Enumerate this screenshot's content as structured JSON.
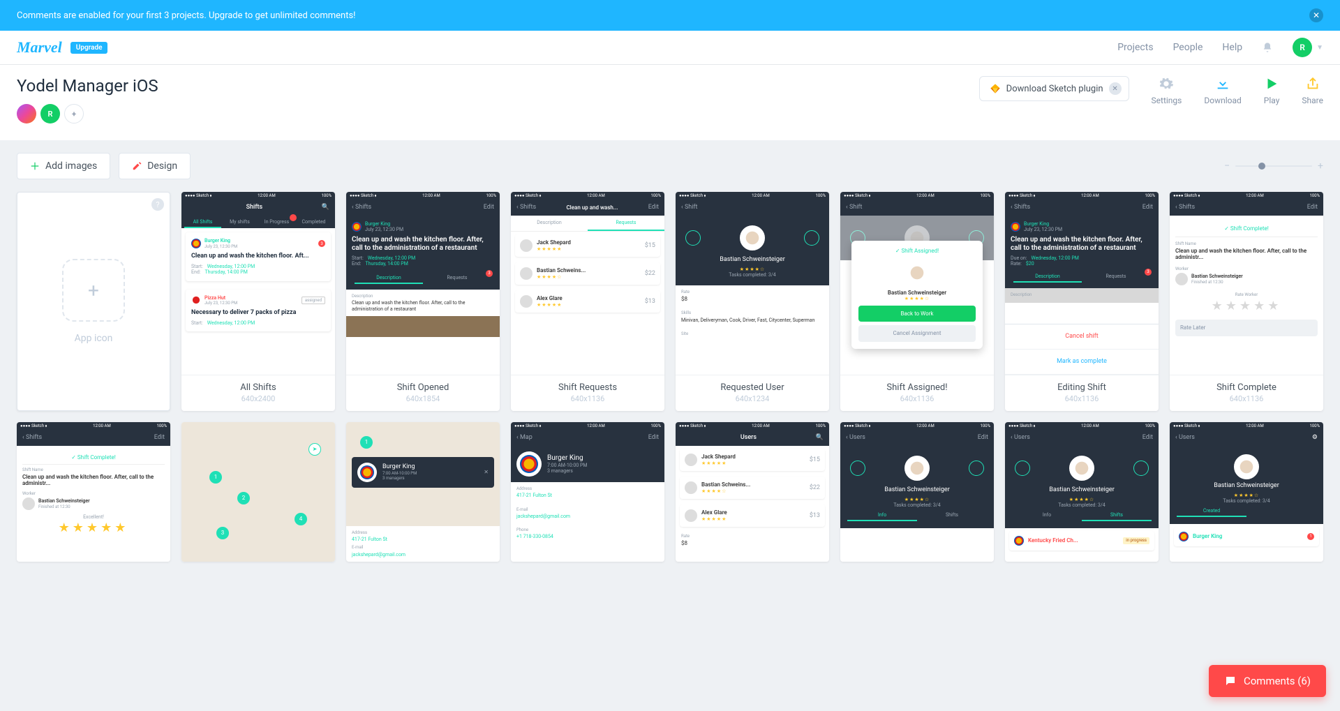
{
  "banner": {
    "text": "Comments are enabled for your first 3 projects. Upgrade to get unlimited comments!"
  },
  "brand": {
    "logo": "Marvel",
    "upgrade": "Upgrade"
  },
  "nav": {
    "projects": "Projects",
    "people": "People",
    "help": "Help",
    "avatar": "R"
  },
  "project": {
    "title": "Yodel Manager iOS",
    "avatar1": "",
    "avatar2": "R",
    "add": "+"
  },
  "sketch": {
    "label": "Download Sketch plugin"
  },
  "actions": {
    "settings": "Settings",
    "download": "Download",
    "play": "Play",
    "share": "Share"
  },
  "toolbar": {
    "add_images": "Add images",
    "design": "Design"
  },
  "app_icon": {
    "label": "App icon"
  },
  "screens": [
    {
      "title": "All Shifts",
      "dim": "640x2400"
    },
    {
      "title": "Shift Opened",
      "dim": "640x1854"
    },
    {
      "title": "Shift Requests",
      "dim": "640x1136"
    },
    {
      "title": "Requested User",
      "dim": "640x1234"
    },
    {
      "title": "Shift Assigned!",
      "dim": "640x1136"
    },
    {
      "title": "Editing Shift",
      "dim": "640x1136"
    },
    {
      "title": "Shift Complete",
      "dim": "640x1136"
    }
  ],
  "phone": {
    "carrier": "Sketch",
    "time": "12:00 AM",
    "pct": "100%",
    "shifts_title": "Shifts",
    "edit": "Edit",
    "back_shifts": "Shifts",
    "back_shift": "Shift",
    "back_users": "Users",
    "back_map": "Map",
    "tabs": {
      "all": "All Shifts",
      "my": "My shifts",
      "prog": "In Progress",
      "comp": "Completed"
    },
    "bk": "Burger King",
    "bk_date": "July 23, 12:30 PM",
    "shift1": "Clean up and wash the kitchen floor. Aft...",
    "shift1_full": "Clean up and wash the kitchen floor. After, call to the administration of a restaurant",
    "shift1_med": "Clean up and wash the kitchen floor. After, call to the administr...",
    "start": "Start:",
    "end": "End:",
    "start_v": "Wednesday, 12:00 PM",
    "end_v": "Thursday, 14:00 PM",
    "pizza": "Pizza Hut",
    "pizza_shift": "Necessary to deliver 7 packs of pizza",
    "assigned": "assigned",
    "desc_tab": "Description",
    "req_tab": "Requests",
    "desc_text": "Clean up and wash the kitchen floor. After, call to the administration of a restaurant",
    "u1": "Jack Shepard",
    "u2": "Bastian Schweins...",
    "u2_full": "Bastian Schweinsteiger",
    "u3": "Alex Glare",
    "p1": "$15",
    "p2": "$22",
    "p3": "$13",
    "tasks": "Tasks completed: 3/4",
    "rate": "Rate",
    "rate_v": "$8",
    "skills": "Skills",
    "site": "Site",
    "skills_v": "Minivan, Deliveryman, Cook, Driver, Fast, Citycenter, Superman",
    "due": "Due on:",
    "due_v": "Wednesday, 12:00 PM",
    "rate2": "Rate:",
    "rate2_v": "$20",
    "assigned_title": "Shift Assigned!",
    "back_work": "Back to Work",
    "cancel_assign": "Cancel Assignment",
    "cancel_shift": "Cancel shift",
    "mark_complete": "Mark as complete",
    "complete_title": "Shift Complete!",
    "shift_name": "Shift Name",
    "worker": "Worker",
    "finished": "Finished at 12:30",
    "rate_worker": "Rate Worker",
    "rate_later": "Rate Later",
    "excellent": "Excellent!",
    "users_title": "Users",
    "info": "Info",
    "shifts_tab": "Shifts",
    "created": "Created",
    "bk_hours": "7:00 AM-10:00 PM",
    "bk_mgrs": "3 managers",
    "address": "Address",
    "address_v": "417-21 Fulton St",
    "email": "E-mail",
    "email_v": "jackshepard@gmail.com",
    "phone": "Phone",
    "phone_v": "+1 718-330-0854",
    "kfc": "Kentucky Fried Ch...",
    "in_progress": "in progress"
  },
  "comments": {
    "label": "Comments (6)"
  }
}
